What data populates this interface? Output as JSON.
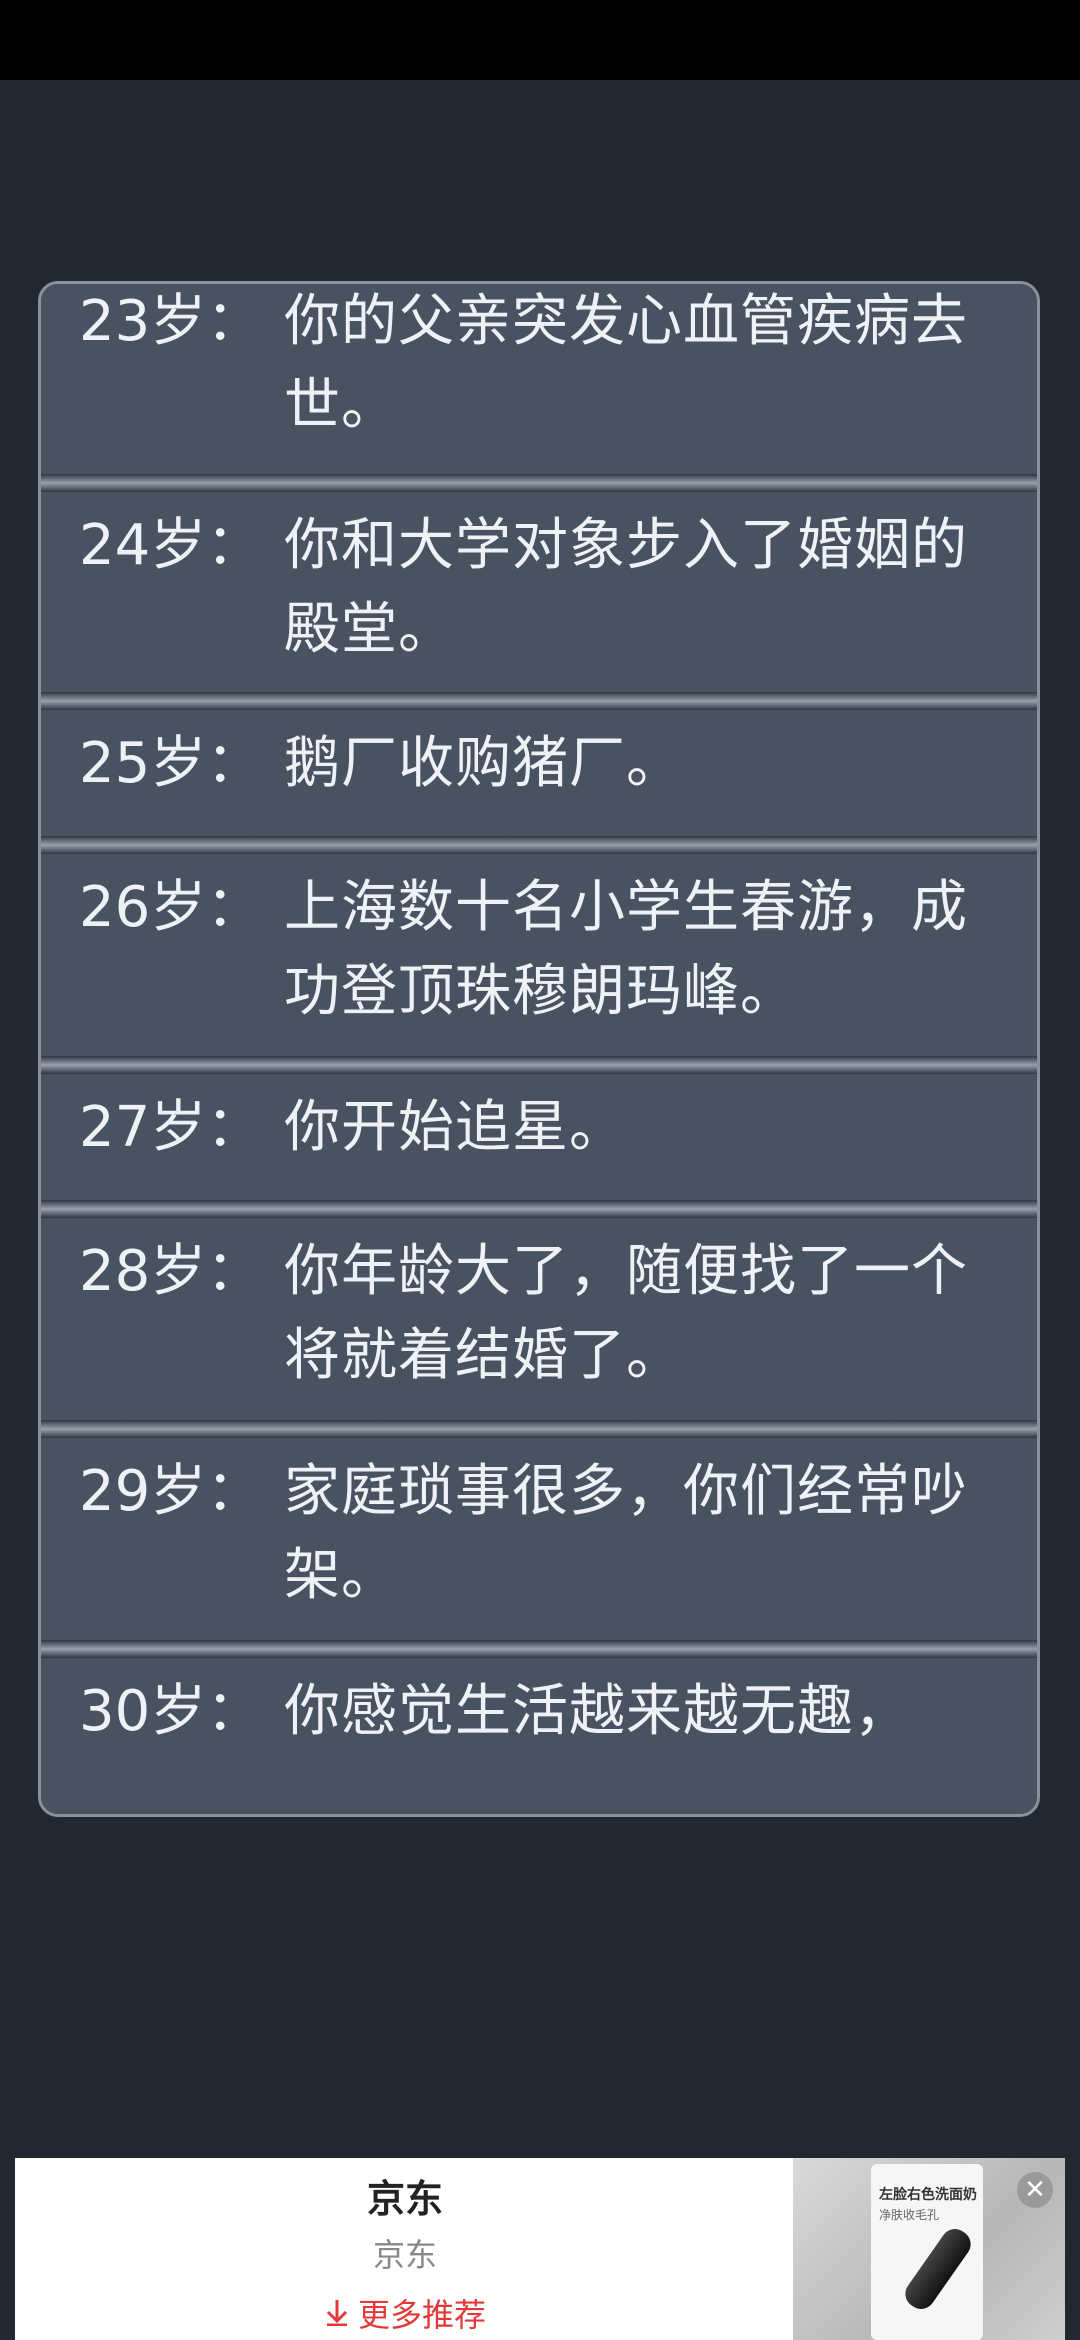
{
  "events": [
    {
      "age": "23岁：",
      "text": "你的父亲突发心血管疾病去世。"
    },
    {
      "age": "24岁：",
      "text": "你和大学对象步入了婚姻的殿堂。"
    },
    {
      "age": "25岁：",
      "text": "鹅厂收购猪厂。"
    },
    {
      "age": "26岁：",
      "text": "上海数十名小学生春游，成功登顶珠穆朗玛峰。"
    },
    {
      "age": "27岁：",
      "text": "你开始追星。"
    },
    {
      "age": "28岁：",
      "text": "你年龄大了，随便找了一个将就着结婚了。"
    },
    {
      "age": "29岁：",
      "text": "家庭琐事很多，你们经常吵架。"
    },
    {
      "age": "30岁：",
      "text": "你感觉生活越来越无趣，"
    }
  ],
  "ad": {
    "title": "京东",
    "subtitle": "京东",
    "more_label": "更多推荐",
    "more_icon": "download-arrow-icon",
    "close_icon": "close-icon",
    "image_text": "左脸右色洗面奶",
    "image_subtext": "净肤收毛孔"
  },
  "colors": {
    "background": "#222830",
    "card": "#485261",
    "text": "#eef1f5",
    "ad_accent": "#e23a3a"
  }
}
